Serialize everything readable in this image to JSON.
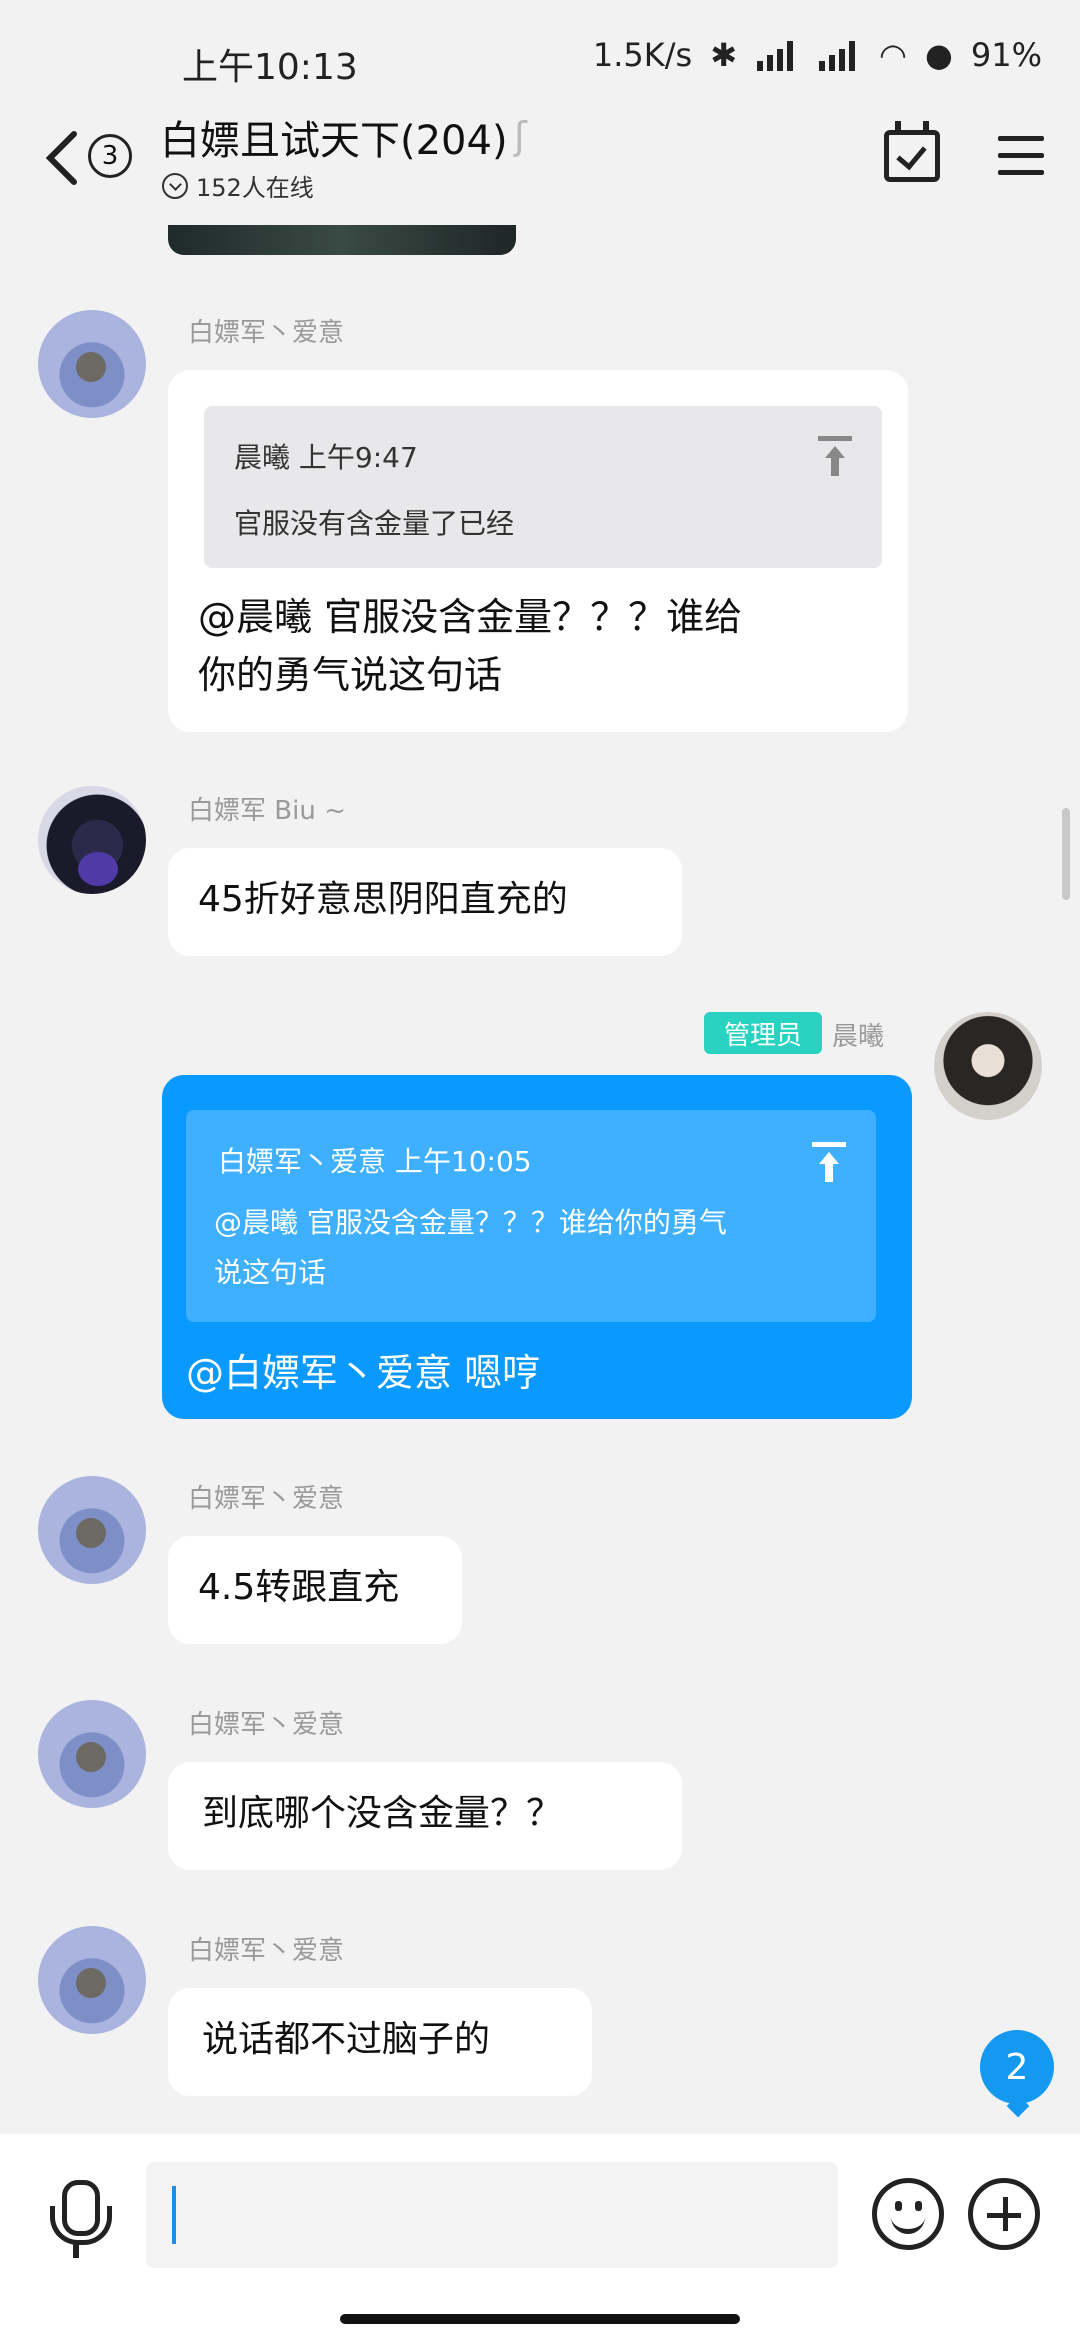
{
  "status_bar": {
    "time": "上午10:13",
    "net_speed": "1.5K/s",
    "battery": "91%"
  },
  "header": {
    "unread_count": "3",
    "title": "白嫖且试天下(204)",
    "online": "152人在线"
  },
  "messages": [
    {
      "sender": "白嫖军丶爱意",
      "quote_author": "晨曦",
      "quote_time": "上午9:47",
      "quote_text": "官服没有含金量了已经",
      "text_line1": "@晨曦 官服没含金量？？？谁给",
      "text_line2": "你的勇气说这句话"
    },
    {
      "sender": "白嫖军 Biu ~",
      "text": "45折好意思阴阳直充的"
    },
    {
      "sender": "晨曦",
      "badge": "管理员",
      "quote_author": "白嫖军丶爱意",
      "quote_time": "上午10:05",
      "quote_line1": "@晨曦 官服没含金量？？？谁给你的勇气",
      "quote_line2": "说这句话",
      "text": "@白嫖军丶爱意 嗯哼"
    },
    {
      "sender": "白嫖军丶爱意",
      "text": "4.5转跟直充"
    },
    {
      "sender": "白嫖军丶爱意",
      "text": "到底哪个没含金量？？"
    },
    {
      "sender": "白嫖军丶爱意",
      "text": "说话都不过脑子的"
    }
  ],
  "new_message_count": "2",
  "input": {
    "value": "",
    "placeholder": ""
  },
  "colors": {
    "accent": "#0a99ff",
    "badge": "#2ad3c1",
    "background": "#f2f2f3"
  }
}
